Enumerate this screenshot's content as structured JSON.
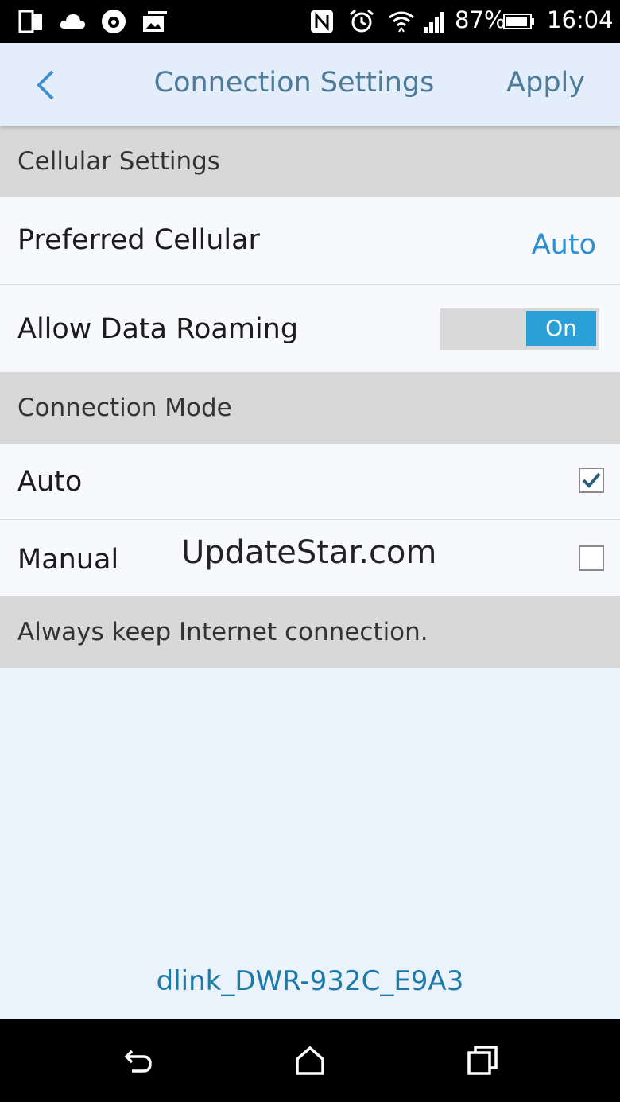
{
  "status_bar": {
    "battery": "87%",
    "time": "16:04",
    "left_icons": [
      "tablet-icon",
      "cloud-icon",
      "shield-bug-icon",
      "photo-stack-icon"
    ],
    "right_icons": [
      "nfc-icon",
      "alarm-icon",
      "wifi-icon",
      "signal-icon",
      "battery-icon"
    ]
  },
  "header": {
    "title": "Connection Settings",
    "apply_label": "Apply",
    "back_icon": "chevron-left-icon"
  },
  "cellular_section": {
    "title": "Cellular Settings",
    "preferred_label": "Preferred Cellular",
    "preferred_value": "Auto",
    "roaming_label": "Allow Data Roaming",
    "roaming_toggle": "On"
  },
  "mode_section": {
    "title": "Connection Mode",
    "options": [
      {
        "label": "Auto",
        "checked": true
      },
      {
        "label": "Manual",
        "checked": false
      }
    ]
  },
  "watermark": "UpdateStar.com",
  "footer_note": "Always keep Internet connection.",
  "device_name": "dlink_DWR-932C_E9A3",
  "colors": {
    "accent": "#2b8fd0",
    "toggle_on": "#2a9fd8",
    "header_bg": "#e3eefa",
    "section_bg": "#d8d8d8"
  },
  "nav_bar": {
    "icons": [
      "back-icon",
      "home-icon",
      "recents-icon"
    ]
  }
}
